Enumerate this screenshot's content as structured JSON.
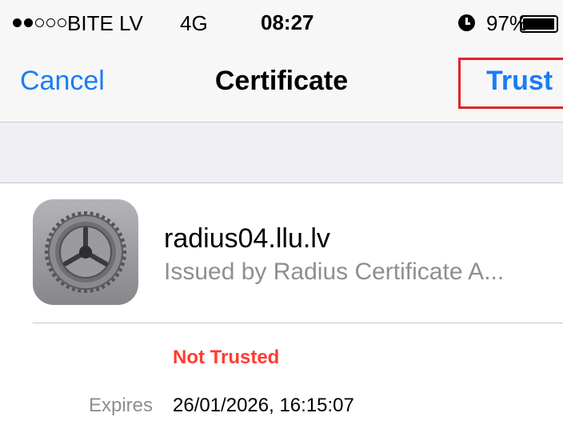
{
  "status_bar": {
    "signal_strength": 2,
    "signal_total": 5,
    "carrier": "BITE LV",
    "network": "4G",
    "time": "08:27",
    "battery": "97%",
    "battery_level": 0.97
  },
  "nav": {
    "cancel_label": "Cancel",
    "title": "Certificate",
    "trust_label": "Trust"
  },
  "certificate": {
    "icon": "settings-gear-icon",
    "name": "radius04.llu.lv",
    "issuer": "Issued by Radius Certificate A...",
    "status": "Not Trusted",
    "expires_label": "Expires",
    "expires_value": "26/01/2026, 16:15:07"
  },
  "colors": {
    "accent": "#1a7cf5",
    "warning": "#ff3b30",
    "highlight": "#e0242b"
  }
}
